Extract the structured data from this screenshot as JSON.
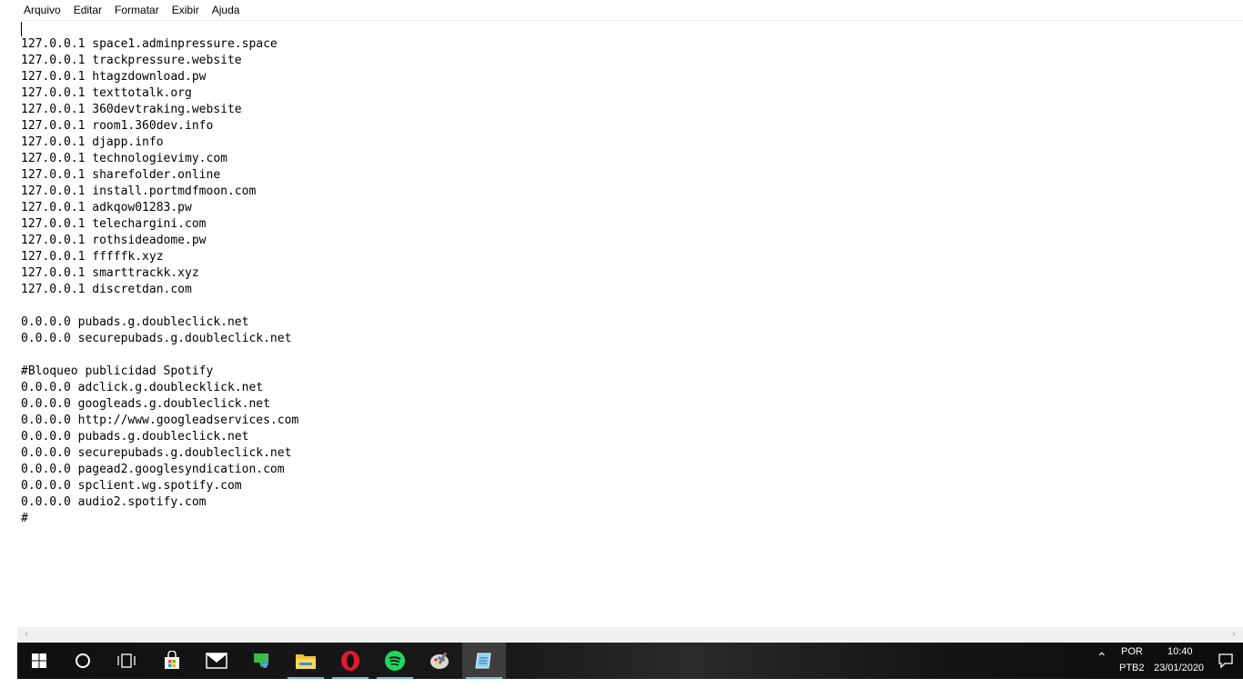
{
  "menu": {
    "items": [
      "Arquivo",
      "Editar",
      "Formatar",
      "Exibir",
      "Ajuda"
    ]
  },
  "editor": {
    "lines": [
      "127.0.0.1 space1.adminpressure.space",
      "127.0.0.1 trackpressure.website",
      "127.0.0.1 htagzdownload.pw",
      "127.0.0.1 texttotalk.org",
      "127.0.0.1 360devtraking.website",
      "127.0.0.1 room1.360dev.info",
      "127.0.0.1 djapp.info",
      "127.0.0.1 technologievimy.com",
      "127.0.0.1 sharefolder.online",
      "127.0.0.1 install.portmdfmoon.com",
      "127.0.0.1 adkqow01283.pw",
      "127.0.0.1 telechargini.com",
      "127.0.0.1 rothsideadome.pw",
      "127.0.0.1 fffffk.xyz",
      "127.0.0.1 smarttrackk.xyz",
      "127.0.0.1 discretdan.com",
      "",
      "0.0.0.0 pubads.g.doubleclick.net",
      "0.0.0.0 securepubads.g.doubleclick.net",
      "",
      "#Bloqueo publicidad Spotify",
      "0.0.0.0 adclick.g.doublecklick.net",
      "0.0.0.0 googleads.g.doubleclick.net",
      "0.0.0.0 http://www.googleadservices.com",
      "0.0.0.0 pubads.g.doubleclick.net",
      "0.0.0.0 securepubads.g.doubleclick.net",
      "0.0.0.0 pagead2.googlesyndication.com",
      "0.0.0.0 spclient.wg.spotify.com",
      "0.0.0.0 audio2.spotify.com",
      "#"
    ]
  },
  "taskbar": {
    "apps": [
      {
        "icon": "store-bag-icon",
        "active": false,
        "color": "#f3f3f3"
      },
      {
        "icon": "mail-icon",
        "active": false,
        "color": "#ffffff"
      },
      {
        "icon": "media-app-icon",
        "active": false,
        "color": "#3dbb4a"
      },
      {
        "icon": "file-explorer-icon",
        "active": false,
        "color": "#f2c335"
      },
      {
        "icon": "opera-icon",
        "active": false,
        "color": "#e3192c"
      },
      {
        "icon": "spotify-icon",
        "active": false,
        "color": "#1ed760"
      },
      {
        "icon": "paint-icon",
        "active": false,
        "color": "#d9d9d9"
      },
      {
        "icon": "notepad-icon",
        "active": true,
        "color": "#8fd3f5"
      }
    ],
    "tray": {
      "language": "POR",
      "layout": "PTB2",
      "time": "10:40",
      "date": "23/01/2020"
    }
  },
  "colors": {
    "taskbar_bg": "#101010",
    "active_underline": "#76b9ed"
  }
}
